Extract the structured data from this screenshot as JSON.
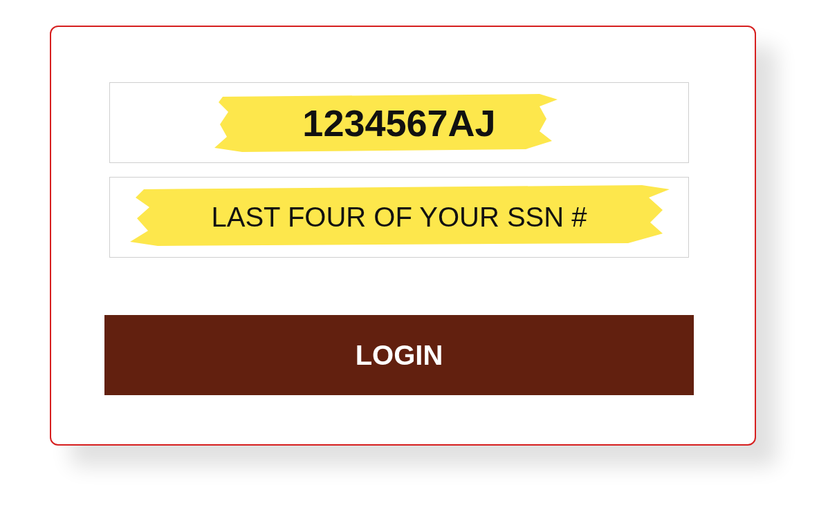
{
  "fields": [
    {
      "kind": "id",
      "value": "1234567AJ"
    },
    {
      "kind": "ssn",
      "placeholder": "LAST FOUR OF YOUR SSN #"
    }
  ],
  "button": {
    "label": "LOGIN"
  }
}
